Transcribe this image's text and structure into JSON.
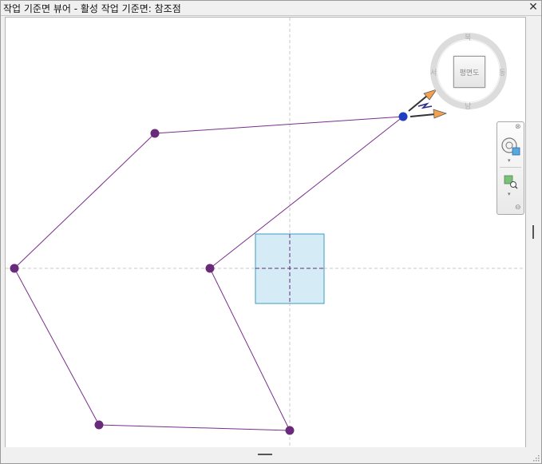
{
  "window": {
    "title": "작업 기준면 뷰어 - 활성 작업 기준면: 참조점",
    "close_glyph": "✕"
  },
  "viewcube": {
    "face_label": "평면도",
    "compass": {
      "north": "북",
      "south": "남",
      "east": "동",
      "west": "서"
    }
  },
  "navbar": {
    "close_glyph": "⊗",
    "minimize_glyph": "⊖",
    "dropdown_glyph": "▾"
  },
  "colors": {
    "path_line": "#7a2e8a",
    "point": "#6a2a7a",
    "active_point": "#1f3fc0",
    "workplane_fill": "#d5ecf6",
    "workplane_stroke": "#3a9bc0",
    "arrow": "#f0a050",
    "crosshair": "#c8c8c8"
  }
}
